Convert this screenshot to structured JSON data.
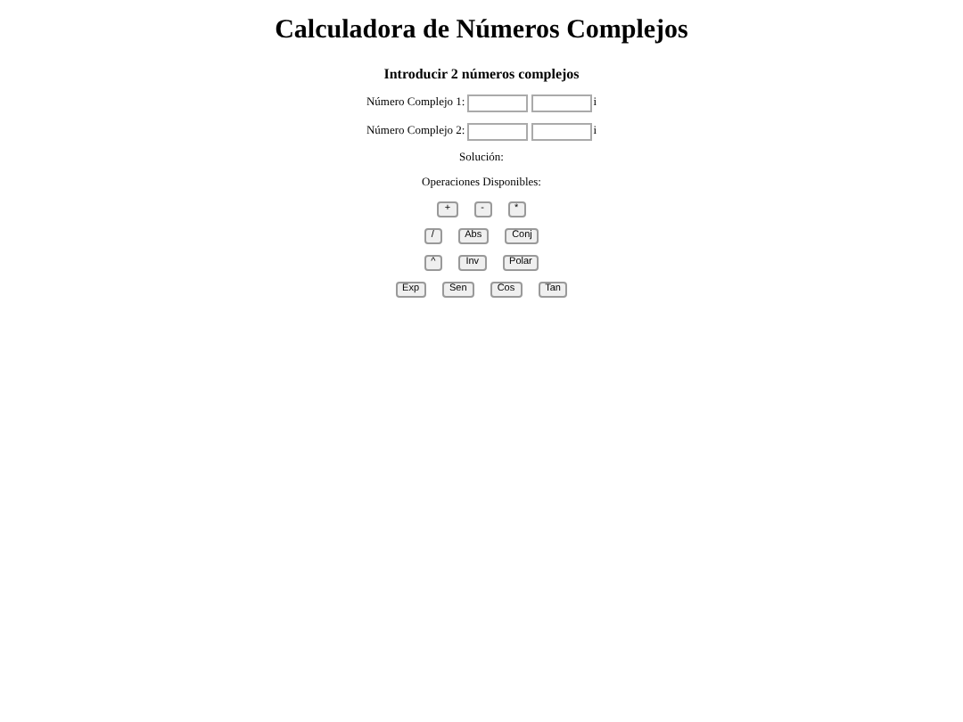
{
  "title": "Calculadora de Números Complejos",
  "subtitle": "Introducir 2 números complejos",
  "inputs": [
    {
      "label": "Número Complejo 1:",
      "suffix": "i"
    },
    {
      "label": "Número Complejo 2:",
      "suffix": "i"
    }
  ],
  "solution_label": "Solución:",
  "operations_label": "Operaciones Disponibles:",
  "button_rows": [
    [
      "+",
      "-",
      "*"
    ],
    [
      "/",
      "Abs",
      "Conj"
    ],
    [
      "^",
      "Inv",
      "Polar"
    ],
    [
      "Exp",
      "Sen",
      "Cos",
      "Tan"
    ]
  ]
}
